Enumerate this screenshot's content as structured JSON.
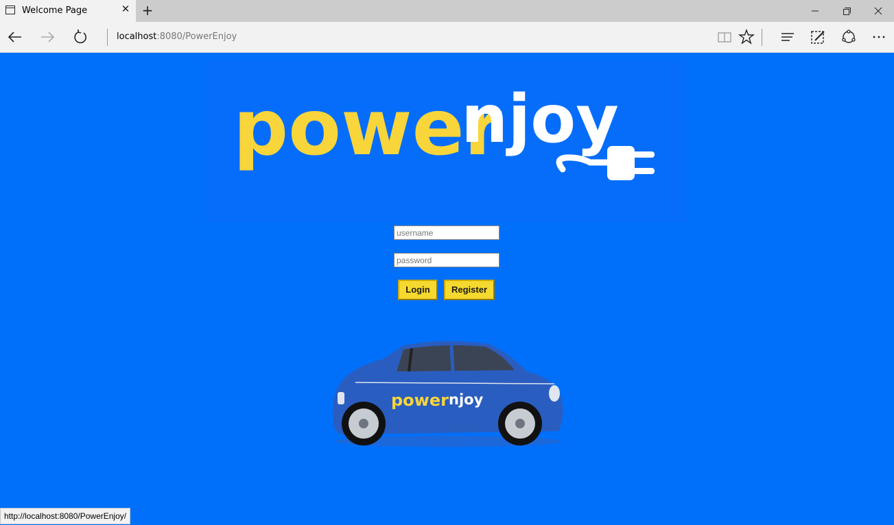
{
  "browser": {
    "tab_title": "Welcome Page",
    "address_host": "localhost",
    "address_rest": ":8080/PowerEnjoy",
    "status_url": "http://localhost:8080/PowerEnjoy/"
  },
  "icons": {
    "tab": "page-icon",
    "back": "back-arrow-icon",
    "forward": "forward-arrow-icon",
    "refresh": "refresh-icon",
    "reading_view": "reading-view-icon",
    "favorite": "star-icon",
    "hub": "hub-icon",
    "web_note": "pen-icon",
    "share": "share-icon",
    "more": "more-icon"
  },
  "logo": {
    "part1": "power",
    "part2": "njoy"
  },
  "login": {
    "username_placeholder": "username",
    "password_placeholder": "password",
    "login_label": "Login",
    "register_label": "Register"
  },
  "colors": {
    "page_bg": "#0070fa",
    "logo_yellow": "#f8d53a",
    "button_yellow": "#f6d92e",
    "car_blue": "#2a5dc0"
  }
}
